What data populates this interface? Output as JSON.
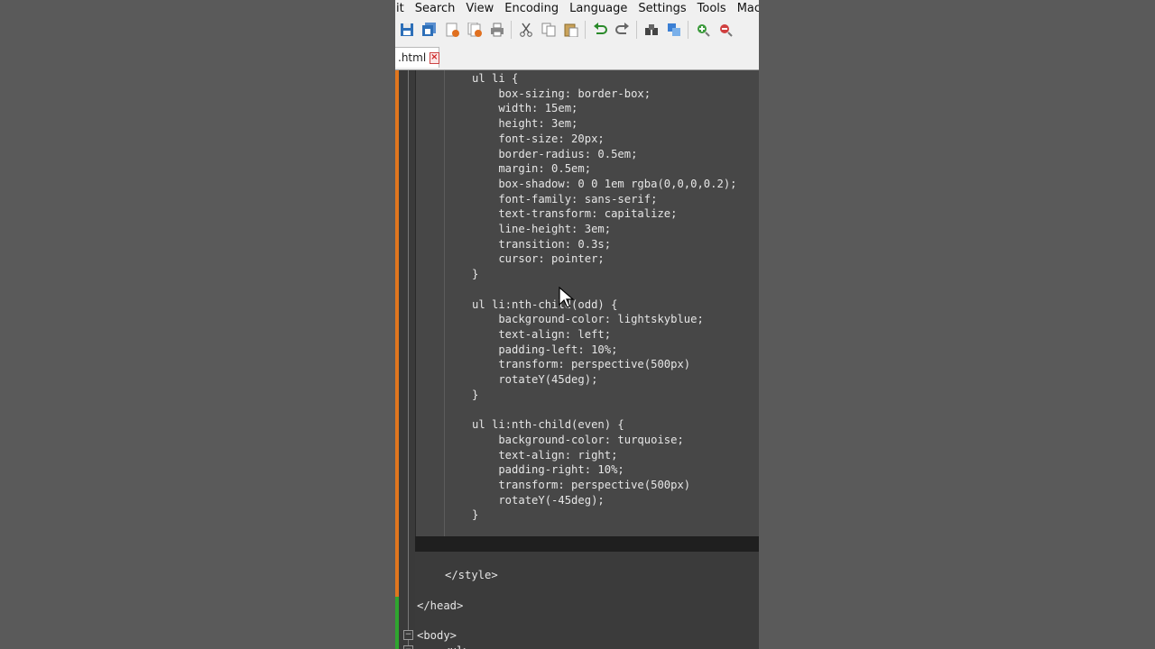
{
  "menu": [
    "it",
    "Search",
    "View",
    "Encoding",
    "Language",
    "Settings",
    "Tools",
    "Mac"
  ],
  "toolbar_icons": [
    "save-icon",
    "save-all-icon",
    "close-icon",
    "close-all-icon",
    "print-icon",
    "cut-icon",
    "copy-icon",
    "paste-icon",
    "undo-icon",
    "redo-icon",
    "find-icon",
    "replace-icon",
    "zoom-in-icon",
    "zoom-out-icon"
  ],
  "tab": {
    "label": ".html",
    "close": "×"
  },
  "code_lines": [
    "ul li {",
    "    box-sizing: border-box;",
    "    width: 15em;",
    "    height: 3em;",
    "    font-size: 20px;",
    "    border-radius: 0.5em;",
    "    margin: 0.5em;",
    "    box-shadow: 0 0 1em rgba(0,0,0,0.2);",
    "    font-family: sans-serif;",
    "    text-transform: capitalize;",
    "    line-height: 3em;",
    "    transition: 0.3s;",
    "    cursor: pointer;",
    "}",
    "",
    "ul li:nth-child(odd) {",
    "    background-color: lightskyblue;",
    "    text-align: left;",
    "    padding-left: 10%;",
    "    transform: perspective(500px)",
    "    rotateY(45deg);",
    "}",
    "",
    "ul li:nth-child(even) {",
    "    background-color: turquoise;",
    "    text-align: right;",
    "    padding-right: 10%;",
    "    transform: perspective(500px)",
    "    rotateY(-45deg);",
    "}",
    "",
    "",
    "",
    "</style>",
    "",
    "</head>",
    "",
    "<body>",
    "    <ul>"
  ]
}
